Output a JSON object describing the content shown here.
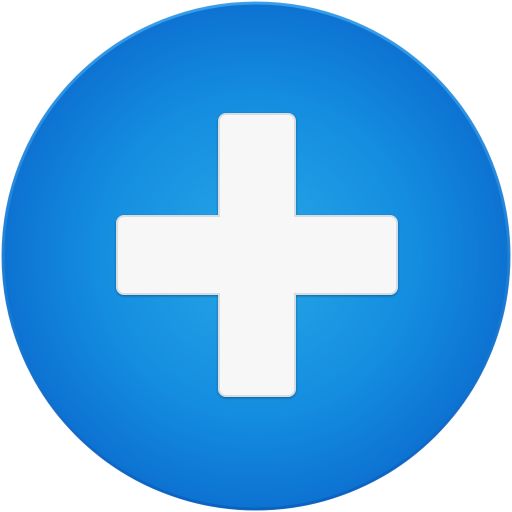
{
  "button": {
    "label": "",
    "icon": "plus-icon"
  },
  "colors": {
    "circle_center": "#27a8e6",
    "circle_mid": "#148de0",
    "circle_edge": "#0c6fd0",
    "circle_rim": "#0a63c2",
    "plus_fill": "#f7f7f7",
    "plus_stroke": "#d8dde3"
  }
}
